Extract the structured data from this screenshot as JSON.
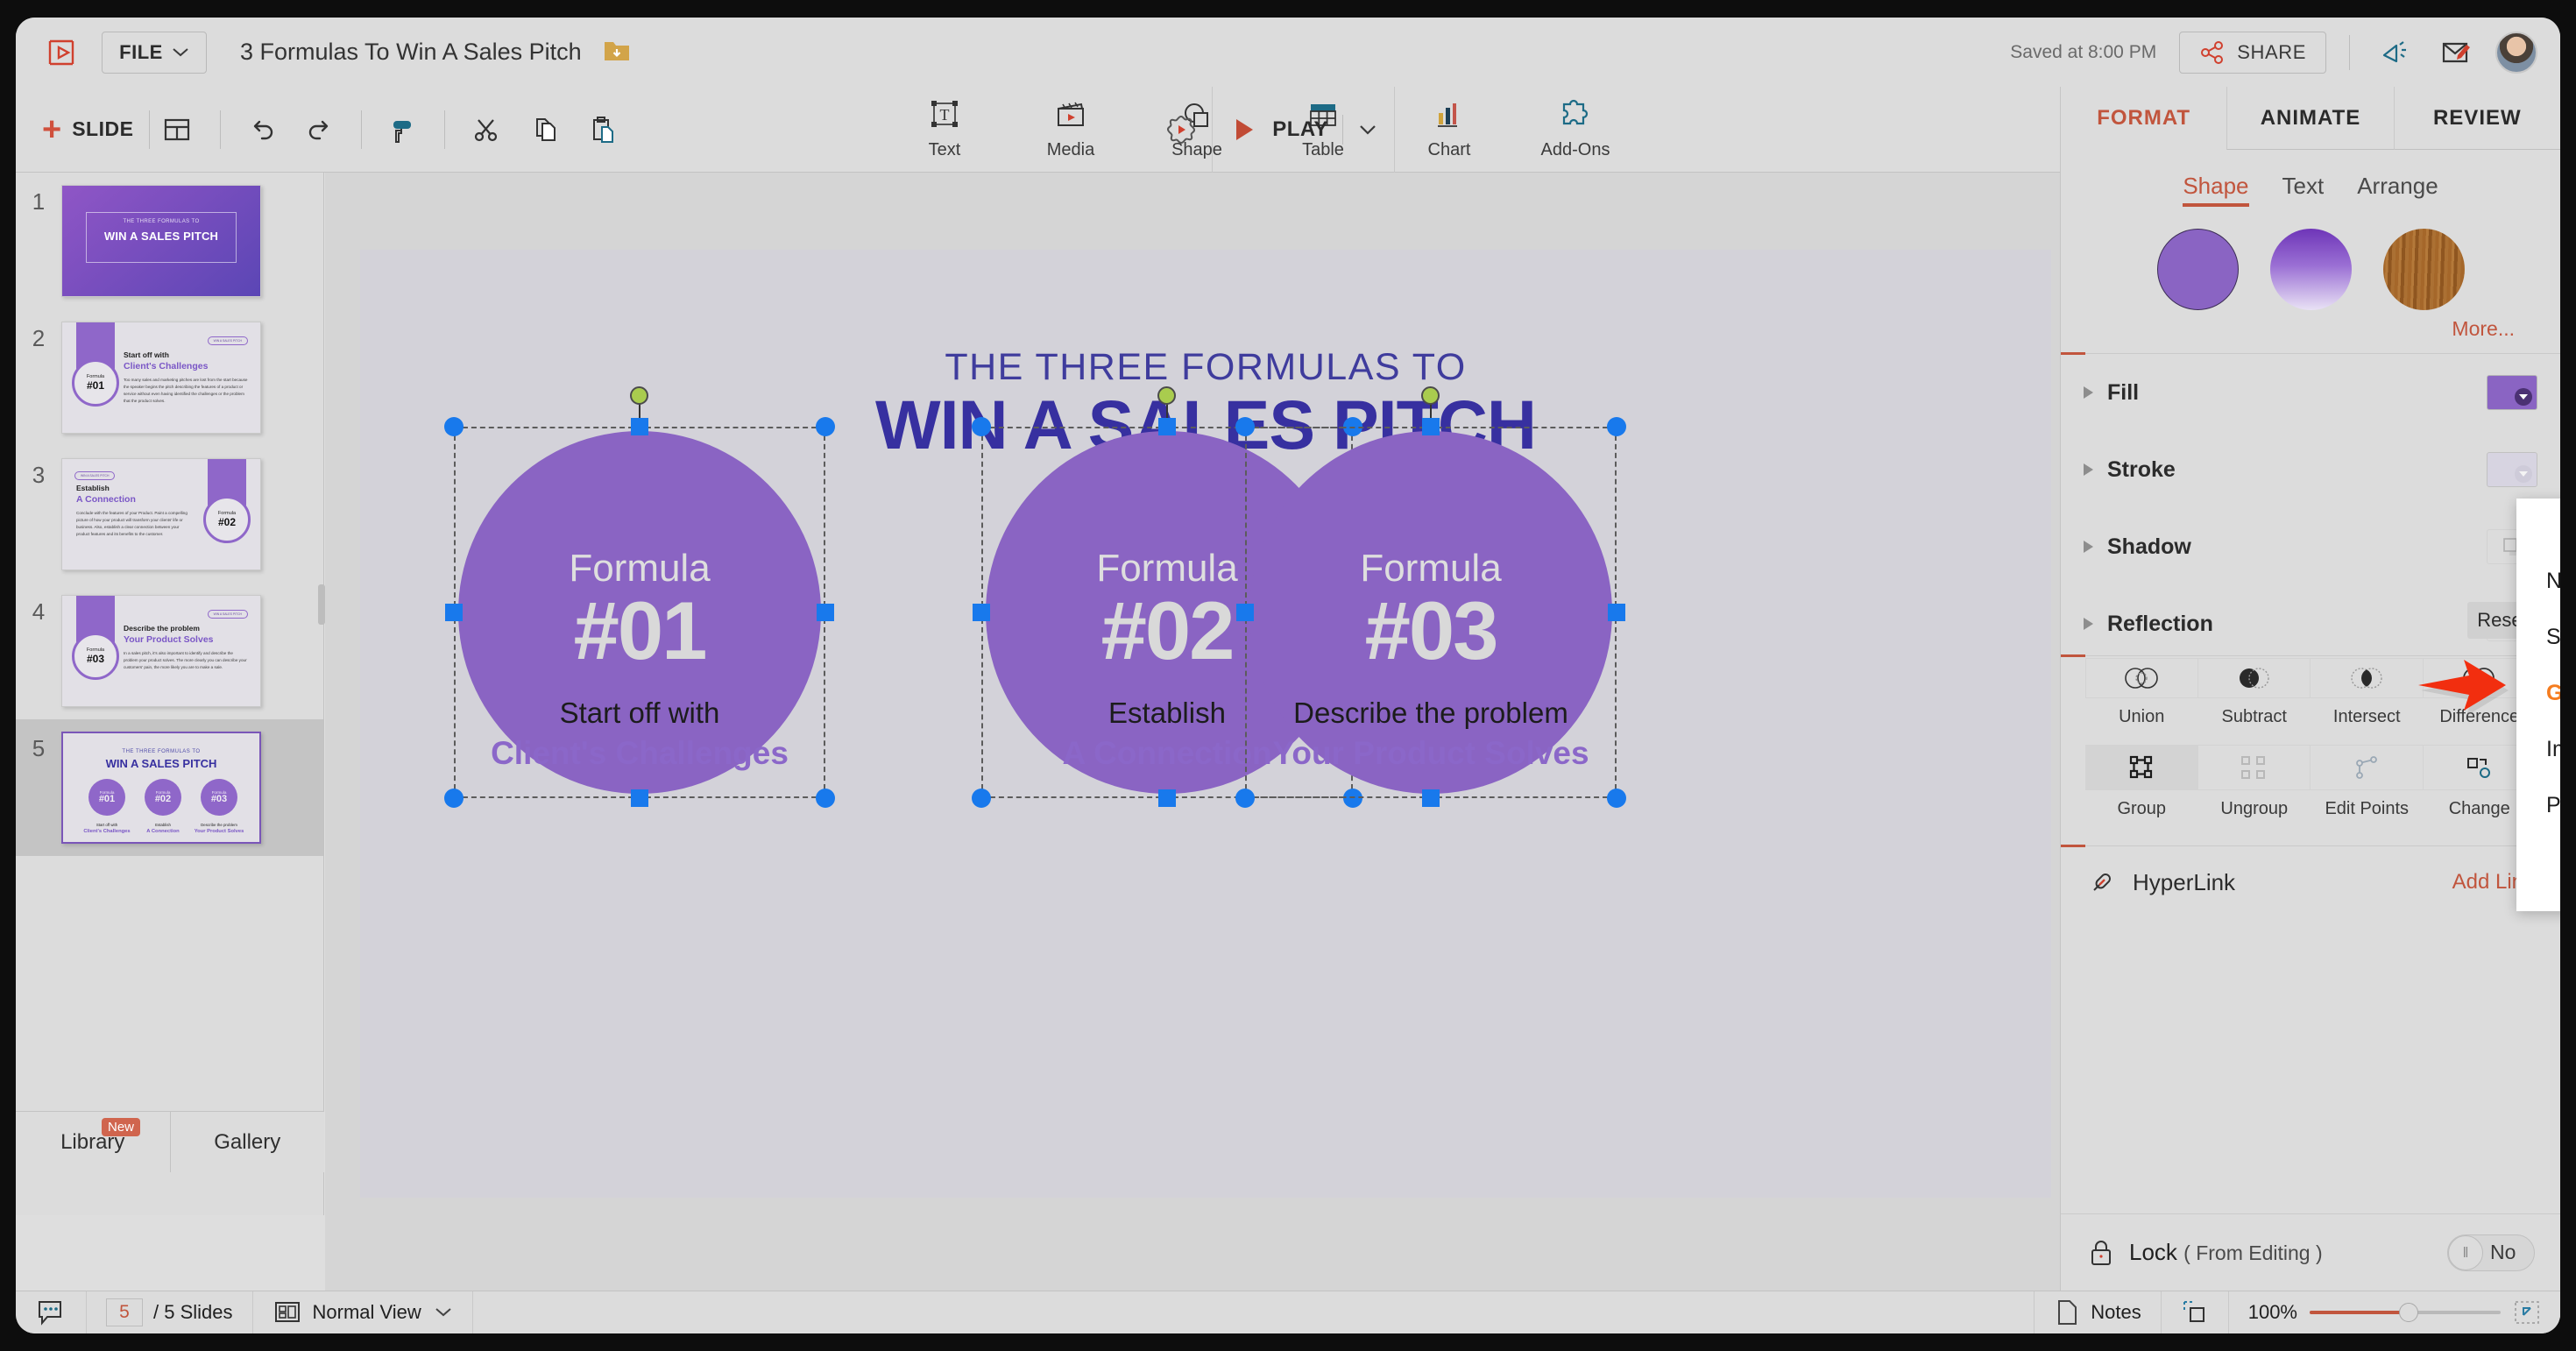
{
  "titlebar": {
    "logo_icon": "presentation-logo-icon",
    "file_menu": "FILE",
    "doc_title": "3 Formulas To Win A Sales Pitch",
    "folder_icon": "folder-download-icon",
    "saved_status": "Saved at 8:00 PM",
    "share_label": "SHARE",
    "announce_icon": "megaphone-icon",
    "feedback_icon": "feedback-pen-icon",
    "avatar": "user-avatar"
  },
  "toolbar": {
    "slide_label": "SLIDE",
    "layout_icon": "layout-icon",
    "undo_icon": "undo-icon",
    "redo_icon": "redo-icon",
    "paint_icon": "paint-roller-icon",
    "cut_icon": "scissors-icon",
    "copy_icon": "copy-icon",
    "paste_icon": "paste-icon",
    "insert_tools": [
      {
        "label": "Text",
        "icon": "text-box-icon"
      },
      {
        "label": "Media",
        "icon": "clapperboard-icon"
      },
      {
        "label": "Shape",
        "icon": "shape-icon"
      },
      {
        "label": "Table",
        "icon": "table-icon"
      },
      {
        "label": "Chart",
        "icon": "bar-chart-icon"
      },
      {
        "label": "Add-Ons",
        "icon": "puzzle-piece-icon"
      }
    ],
    "settings_icon": "gear-icon",
    "play_label": "PLAY",
    "play_icon": "play-triangle-icon",
    "play_chevron": "chevron-down-icon"
  },
  "sidebar": {
    "slides": [
      {
        "num": "1",
        "sub": "THE THREE FORMULAS TO",
        "title": "WIN A SALES PITCH"
      },
      {
        "num": "2",
        "pill": "WIN A SALES PITCH",
        "head1": "Start off with",
        "head2": "Client's Challenges",
        "body": "Too many sales and marketing pitches are lost from the start because the speaker begins the pitch describing the features of a product or service without even having identified the challenges or the problem that the product solves.",
        "formula_label": "Formula",
        "formula_num": "#01"
      },
      {
        "num": "3",
        "pill": "WIN A SALES PITCH",
        "head1": "Establish",
        "head2": "A Connection",
        "body": "Conclude with the features of your Product. Paint a compelling picture of how your product will transform your clients' life or business. Also, establish a clear connection between your product features and its benefits to the customer.",
        "formula_label": "Formula",
        "formula_num": "#02"
      },
      {
        "num": "4",
        "pill": "WIN A SALES PITCH",
        "head1": "Describe the problem",
        "head2": "Your Product Solves",
        "body": "In a sales pitch, it's also important to identify and describe the problem your product solves. The more clearly you can describe your customers' pain, the more likely you are to make a sale.",
        "formula_label": "Formula",
        "formula_num": "#03"
      },
      {
        "num": "5",
        "sub": "THE THREE FORMULAS TO",
        "title": "WIN A SALES PITCH"
      }
    ],
    "library_tab": "Library",
    "library_badge": "New",
    "gallery_tab": "Gallery"
  },
  "slide": {
    "subtitle": "THE THREE FORMULAS TO",
    "title": "WIN A SALES PITCH",
    "shapes": [
      {
        "formula_label": "Formula",
        "formula_num": "#01",
        "cap_top": "Start off with",
        "cap_bottom": "Client's Challenges"
      },
      {
        "formula_label": "Formula",
        "formula_num": "#02",
        "cap_top": "Establish",
        "cap_bottom": "A Connection"
      },
      {
        "formula_label": "Formula",
        "formula_num": "#03",
        "cap_top": "Describe the problem",
        "cap_bottom": "Your Product Solves"
      }
    ]
  },
  "right_panel": {
    "tabs": [
      "FORMAT",
      "ANIMATE",
      "REVIEW"
    ],
    "active_tab": "FORMAT",
    "subtabs": [
      "Shape",
      "Text",
      "Arrange"
    ],
    "active_subtab": "Shape",
    "presets": [
      "solid-purple-circle",
      "gradient-purple-circle",
      "wood-texture-circle"
    ],
    "more_label": "More...",
    "properties": [
      {
        "label": "Fill"
      },
      {
        "label": "Stroke"
      },
      {
        "label": "Shadow"
      },
      {
        "label": "Reflection"
      }
    ],
    "fill_select_value": "Solid Color",
    "fill_dropdown_options": [
      "None",
      "Solid Color",
      "Gradient Colors",
      "Image",
      "Pattern"
    ],
    "fill_dropdown_highlighted": "Gradient Colors",
    "reset_label": "Reset",
    "boolean_ops": [
      {
        "label": "Union",
        "icon": "union-icon"
      },
      {
        "label": "Subtract",
        "icon": "subtract-icon"
      },
      {
        "label": "Intersect",
        "icon": "intersect-icon"
      },
      {
        "label": "Difference",
        "icon": "difference-icon"
      }
    ],
    "group_ops": [
      {
        "label": "Group",
        "icon": "group-icon"
      },
      {
        "label": "Ungroup",
        "icon": "ungroup-icon"
      },
      {
        "label": "Edit Points",
        "icon": "edit-points-icon"
      },
      {
        "label": "Change",
        "icon": "change-shape-icon"
      }
    ],
    "hyperlink_label": "HyperLink",
    "hyperlink_icon": "link-icon",
    "add_link_label": "Add Link",
    "lock_icon": "lock-icon",
    "lock_label": "Lock",
    "lock_sublabel": "( From Editing )",
    "lock_value": "No"
  },
  "statusbar": {
    "comment_icon": "comment-icon",
    "current_page": "5",
    "page_total": "/ 5 Slides",
    "view_icon": "normal-view-icon",
    "view_label": "Normal View",
    "view_chevron": "chevron-down-icon",
    "notes_icon": "notes-page-icon",
    "notes_label": "Notes",
    "fit_icon": "fit-to-screen-icon",
    "zoom_level": "100%",
    "expand_icon": "expand-icon"
  },
  "colors": {
    "accent_red": "#c1553d",
    "purple_shape": "#8a64c3",
    "title_blue": "#3730a0",
    "highlight_orange": "#f57c1f",
    "handle_blue": "#1879ec",
    "rotate_green": "#a9cc4e"
  }
}
